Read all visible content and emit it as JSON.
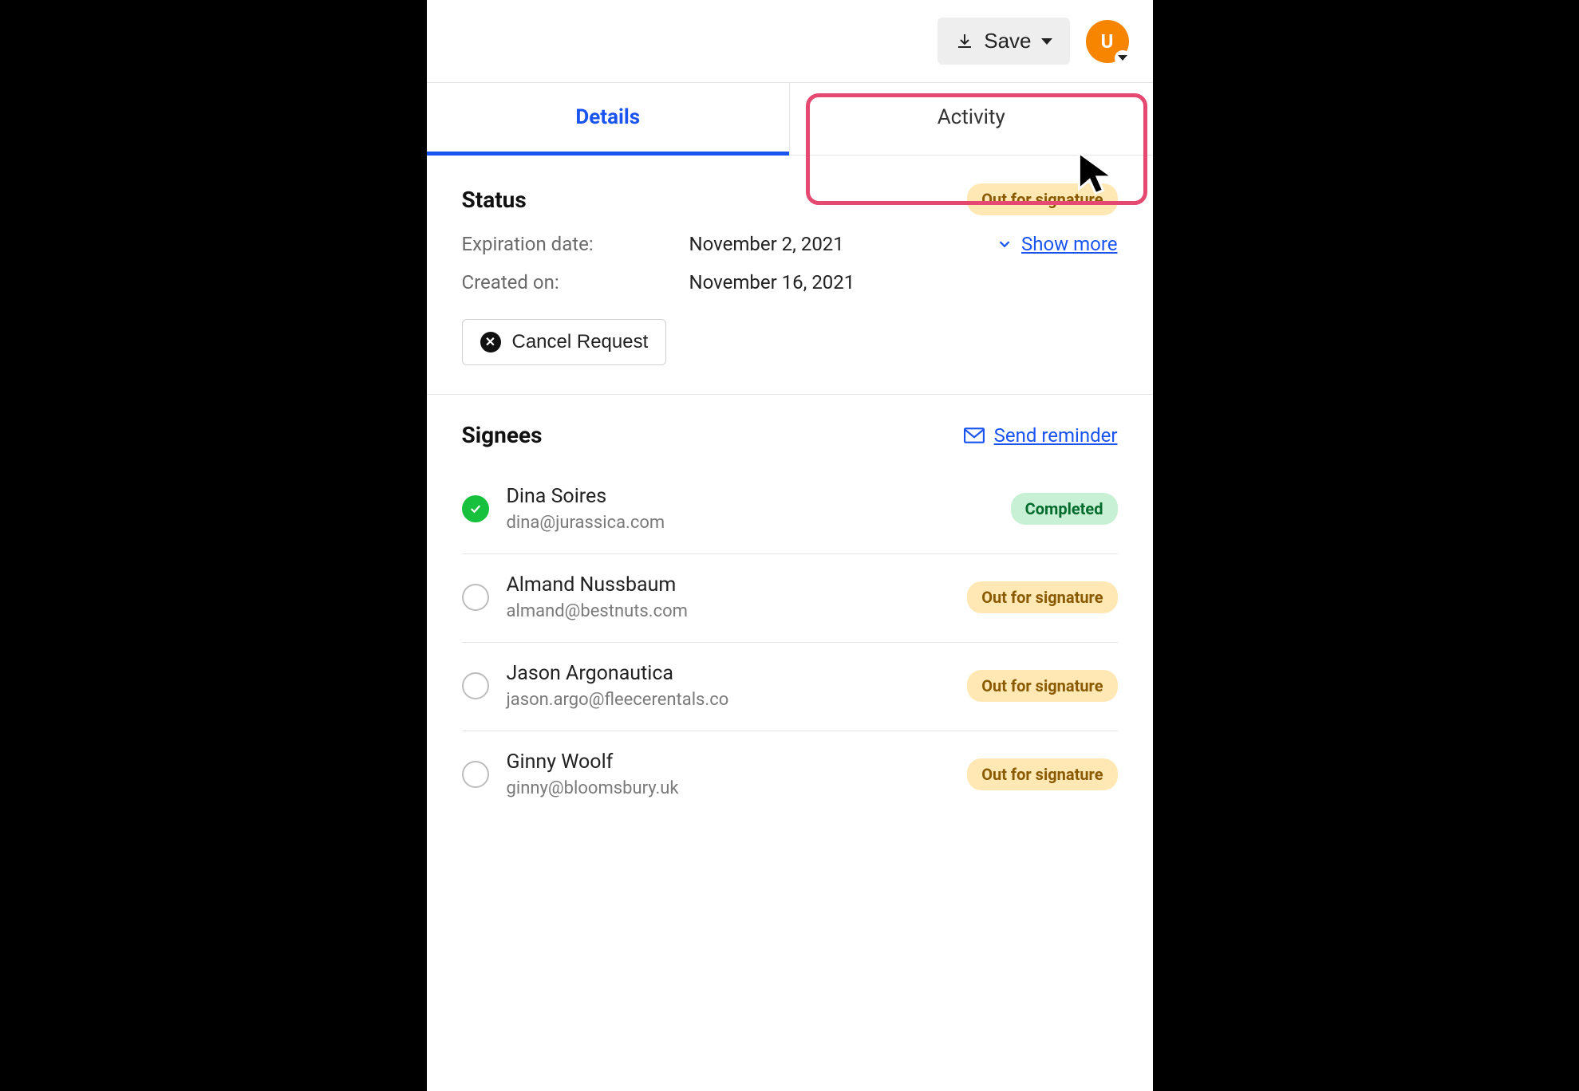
{
  "header": {
    "save_label": "Save",
    "avatar_initial": "U"
  },
  "tabs": {
    "details": "Details",
    "activity": "Activity"
  },
  "status": {
    "heading": "Status",
    "badge": "Out for signature",
    "expiration_label": "Expiration date:",
    "expiration_value": "November 2, 2021",
    "created_label": "Created on:",
    "created_value": "November 16, 2021",
    "show_more": "Show more",
    "cancel_label": "Cancel Request"
  },
  "signees": {
    "heading": "Signees",
    "send_reminder": "Send reminder",
    "list": [
      {
        "name": "Dina Soires",
        "email": "dina@jurassica.com",
        "status": "Completed",
        "completed": true
      },
      {
        "name": "Almand Nussbaum",
        "email": "almand@bestnuts.com",
        "status": "Out for signature",
        "completed": false
      },
      {
        "name": "Jason Argonautica",
        "email": "jason.argo@fleecerentals.co",
        "status": "Out for signature",
        "completed": false
      },
      {
        "name": "Ginny Woolf",
        "email": "ginny@bloomsbury.uk",
        "status": "Out for signature",
        "completed": false
      }
    ]
  }
}
